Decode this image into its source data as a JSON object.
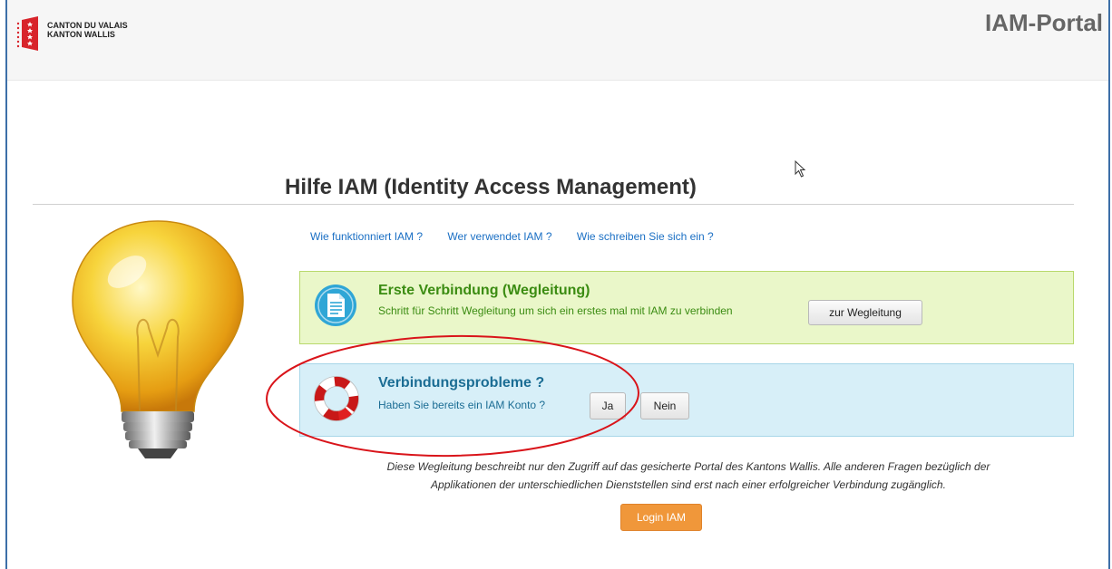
{
  "header": {
    "logo_line1": "CANTON DU VALAIS",
    "logo_line2": "KANTON WALLIS",
    "portal_title": "IAM-Portal"
  },
  "main": {
    "title": "Hilfe IAM (Identity Access Management)",
    "links": [
      "Wie funktionniert IAM ?",
      "Wer verwendet IAM ?",
      "Wie schreiben Sie sich ein ?"
    ],
    "first_connection": {
      "title": "Erste Verbindung (Wegleitung)",
      "text": "Schritt für Schritt Wegleitung um sich ein erstes mal mit IAM zu verbinden",
      "button": "zur Wegleitung"
    },
    "connection_problems": {
      "title": "Verbindungsprobleme ?",
      "text": "Haben Sie bereits ein IAM Konto ?",
      "yes": "Ja",
      "no": "Nein"
    },
    "note_line1": "Diese Wegleitung beschreibt nur den Zugriff auf das gesicherte Portal des Kantons Wallis. Alle anderen Fragen bezüglich der",
    "note_line2": "Applikationen der unterschiedlichen Dienststellen sind erst nach einer erfolgreicher Verbindung zugänglich.",
    "login_button": "Login IAM"
  },
  "colors": {
    "accent_orange": "#f0973a",
    "panel_green": "#eaf7c9",
    "panel_blue": "#d7eff8",
    "annotation_red": "#d9141a"
  },
  "icons": [
    "logo-icon",
    "lightbulb-icon",
    "document-icon",
    "lifebuoy-icon",
    "mouse-cursor-icon"
  ]
}
